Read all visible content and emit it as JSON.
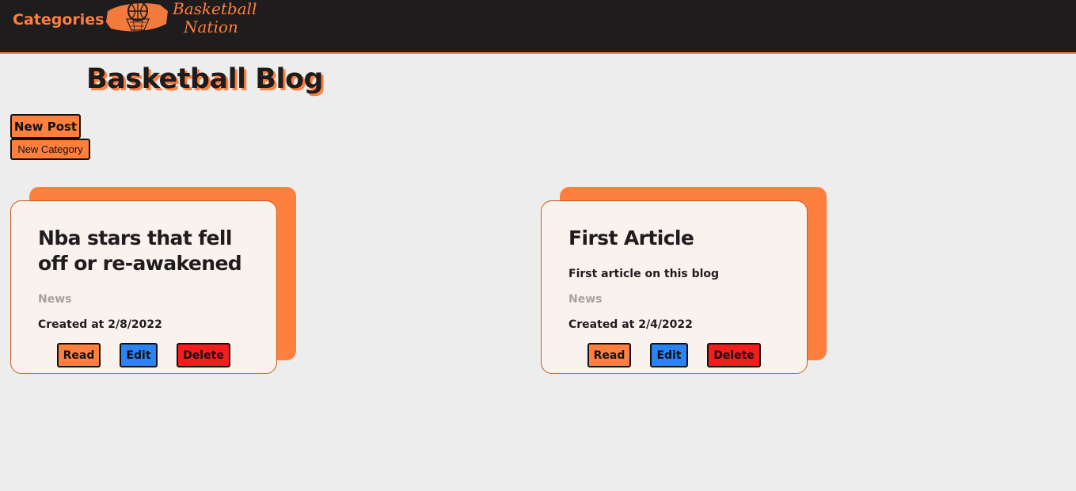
{
  "nav": {
    "categories_label": "Categories",
    "logo_line1": "Basketball",
    "logo_line2": "Nation"
  },
  "page": {
    "title": "Basketball Blog"
  },
  "actions": {
    "new_post": "New Post",
    "new_category": "New Category"
  },
  "posts": [
    {
      "title": "Nba stars that fell off or re-awakened",
      "description": "",
      "category": "News",
      "created": "Created at 2/8/2022",
      "read": "Read",
      "edit": "Edit",
      "delete": "Delete"
    },
    {
      "title": "First Article",
      "description": "First article on this blog",
      "category": "News",
      "created": "Created at 2/4/2022",
      "read": "Read",
      "edit": "Edit",
      "delete": "Delete"
    }
  ],
  "colors": {
    "accent": "#ff7f3f",
    "navbar": "#1e1c1d",
    "edit_button": "#2b83f6",
    "delete_button": "#f21d1d"
  }
}
